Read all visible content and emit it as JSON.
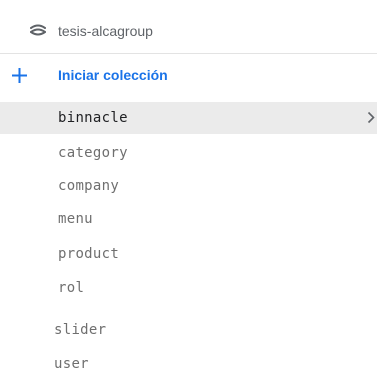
{
  "project": {
    "name": "tesis-alcagroup",
    "icon": "database-icon"
  },
  "actions": {
    "add_collection_label": "Iniciar colección",
    "add_icon": "plus-icon",
    "accent_color": "#1a73e8"
  },
  "collections": [
    {
      "label": "binnacle",
      "selected": true
    },
    {
      "label": "category",
      "selected": false
    },
    {
      "label": "company",
      "selected": false
    },
    {
      "label": "menu",
      "selected": false
    },
    {
      "label": "product",
      "selected": false
    },
    {
      "label": "rol",
      "selected": false
    },
    {
      "label": "slider",
      "selected": false
    },
    {
      "label": "user",
      "selected": false
    }
  ],
  "colors": {
    "selected_background": "#ebebeb",
    "item_text": "#6f6f6f",
    "selected_text": "#202124"
  }
}
